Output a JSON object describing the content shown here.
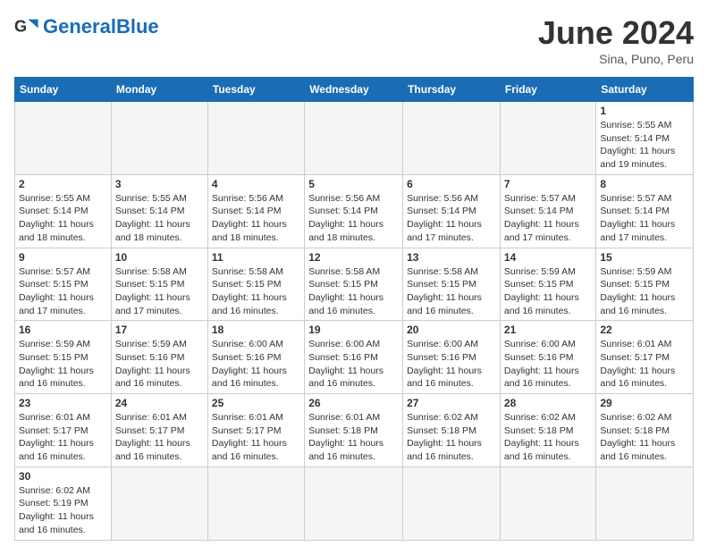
{
  "header": {
    "logo_general": "General",
    "logo_blue": "Blue",
    "month_title": "June 2024",
    "subtitle": "Sina, Puno, Peru"
  },
  "weekdays": [
    "Sunday",
    "Monday",
    "Tuesday",
    "Wednesday",
    "Thursday",
    "Friday",
    "Saturday"
  ],
  "weeks": [
    [
      {
        "day": "",
        "info": ""
      },
      {
        "day": "",
        "info": ""
      },
      {
        "day": "",
        "info": ""
      },
      {
        "day": "",
        "info": ""
      },
      {
        "day": "",
        "info": ""
      },
      {
        "day": "",
        "info": ""
      },
      {
        "day": "1",
        "info": "Sunrise: 5:55 AM\nSunset: 5:14 PM\nDaylight: 11 hours and 19 minutes."
      }
    ],
    [
      {
        "day": "2",
        "info": "Sunrise: 5:55 AM\nSunset: 5:14 PM\nDaylight: 11 hours and 18 minutes."
      },
      {
        "day": "3",
        "info": "Sunrise: 5:55 AM\nSunset: 5:14 PM\nDaylight: 11 hours and 18 minutes."
      },
      {
        "day": "4",
        "info": "Sunrise: 5:56 AM\nSunset: 5:14 PM\nDaylight: 11 hours and 18 minutes."
      },
      {
        "day": "5",
        "info": "Sunrise: 5:56 AM\nSunset: 5:14 PM\nDaylight: 11 hours and 18 minutes."
      },
      {
        "day": "6",
        "info": "Sunrise: 5:56 AM\nSunset: 5:14 PM\nDaylight: 11 hours and 17 minutes."
      },
      {
        "day": "7",
        "info": "Sunrise: 5:57 AM\nSunset: 5:14 PM\nDaylight: 11 hours and 17 minutes."
      },
      {
        "day": "8",
        "info": "Sunrise: 5:57 AM\nSunset: 5:14 PM\nDaylight: 11 hours and 17 minutes."
      }
    ],
    [
      {
        "day": "9",
        "info": "Sunrise: 5:57 AM\nSunset: 5:15 PM\nDaylight: 11 hours and 17 minutes."
      },
      {
        "day": "10",
        "info": "Sunrise: 5:58 AM\nSunset: 5:15 PM\nDaylight: 11 hours and 17 minutes."
      },
      {
        "day": "11",
        "info": "Sunrise: 5:58 AM\nSunset: 5:15 PM\nDaylight: 11 hours and 16 minutes."
      },
      {
        "day": "12",
        "info": "Sunrise: 5:58 AM\nSunset: 5:15 PM\nDaylight: 11 hours and 16 minutes."
      },
      {
        "day": "13",
        "info": "Sunrise: 5:58 AM\nSunset: 5:15 PM\nDaylight: 11 hours and 16 minutes."
      },
      {
        "day": "14",
        "info": "Sunrise: 5:59 AM\nSunset: 5:15 PM\nDaylight: 11 hours and 16 minutes."
      },
      {
        "day": "15",
        "info": "Sunrise: 5:59 AM\nSunset: 5:15 PM\nDaylight: 11 hours and 16 minutes."
      }
    ],
    [
      {
        "day": "16",
        "info": "Sunrise: 5:59 AM\nSunset: 5:15 PM\nDaylight: 11 hours and 16 minutes."
      },
      {
        "day": "17",
        "info": "Sunrise: 5:59 AM\nSunset: 5:16 PM\nDaylight: 11 hours and 16 minutes."
      },
      {
        "day": "18",
        "info": "Sunrise: 6:00 AM\nSunset: 5:16 PM\nDaylight: 11 hours and 16 minutes."
      },
      {
        "day": "19",
        "info": "Sunrise: 6:00 AM\nSunset: 5:16 PM\nDaylight: 11 hours and 16 minutes."
      },
      {
        "day": "20",
        "info": "Sunrise: 6:00 AM\nSunset: 5:16 PM\nDaylight: 11 hours and 16 minutes."
      },
      {
        "day": "21",
        "info": "Sunrise: 6:00 AM\nSunset: 5:16 PM\nDaylight: 11 hours and 16 minutes."
      },
      {
        "day": "22",
        "info": "Sunrise: 6:01 AM\nSunset: 5:17 PM\nDaylight: 11 hours and 16 minutes."
      }
    ],
    [
      {
        "day": "23",
        "info": "Sunrise: 6:01 AM\nSunset: 5:17 PM\nDaylight: 11 hours and 16 minutes."
      },
      {
        "day": "24",
        "info": "Sunrise: 6:01 AM\nSunset: 5:17 PM\nDaylight: 11 hours and 16 minutes."
      },
      {
        "day": "25",
        "info": "Sunrise: 6:01 AM\nSunset: 5:17 PM\nDaylight: 11 hours and 16 minutes."
      },
      {
        "day": "26",
        "info": "Sunrise: 6:01 AM\nSunset: 5:18 PM\nDaylight: 11 hours and 16 minutes."
      },
      {
        "day": "27",
        "info": "Sunrise: 6:02 AM\nSunset: 5:18 PM\nDaylight: 11 hours and 16 minutes."
      },
      {
        "day": "28",
        "info": "Sunrise: 6:02 AM\nSunset: 5:18 PM\nDaylight: 11 hours and 16 minutes."
      },
      {
        "day": "29",
        "info": "Sunrise: 6:02 AM\nSunset: 5:18 PM\nDaylight: 11 hours and 16 minutes."
      }
    ],
    [
      {
        "day": "30",
        "info": "Sunrise: 6:02 AM\nSunset: 5:19 PM\nDaylight: 11 hours and 16 minutes."
      },
      {
        "day": "",
        "info": ""
      },
      {
        "day": "",
        "info": ""
      },
      {
        "day": "",
        "info": ""
      },
      {
        "day": "",
        "info": ""
      },
      {
        "day": "",
        "info": ""
      },
      {
        "day": "",
        "info": ""
      }
    ]
  ]
}
